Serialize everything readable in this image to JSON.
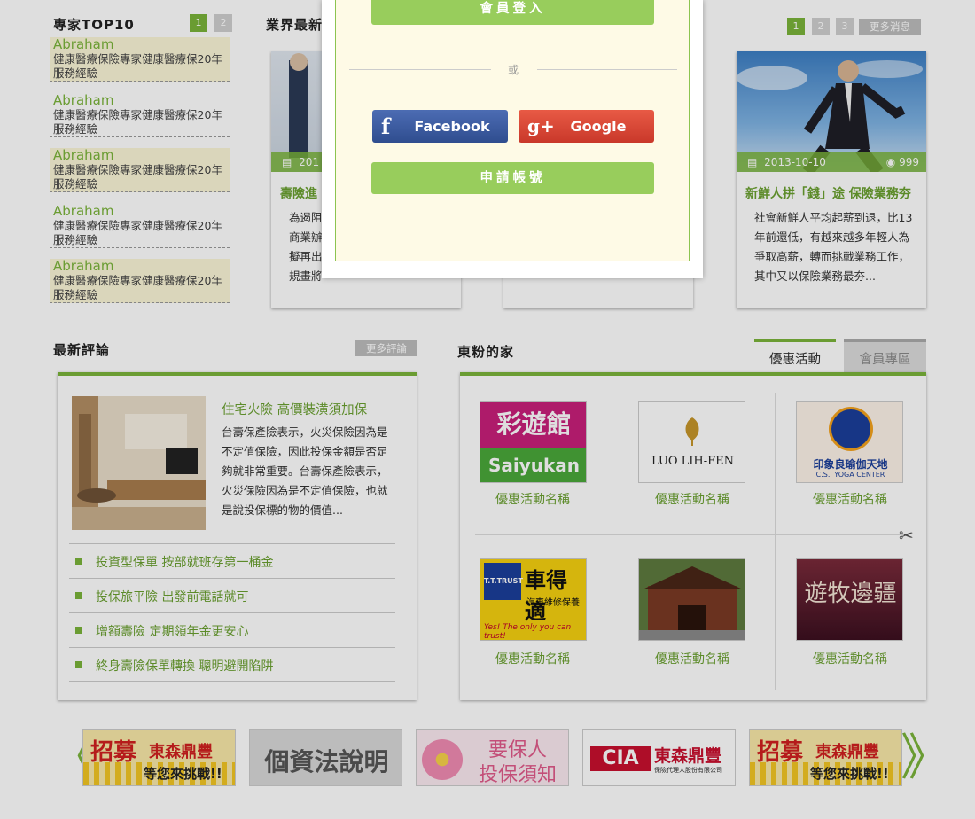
{
  "expert_top10": {
    "title": "專家TOP10",
    "pages": [
      "1",
      "2"
    ],
    "items": [
      {
        "name": "Abraham",
        "desc": "健康醫療保險專家健康醫療保20年服務經驗"
      },
      {
        "name": "Abraham",
        "desc": "健康醫療保險專家健康醫療保20年服務經驗"
      },
      {
        "name": "Abraham",
        "desc": "健康醫療保險專家健康醫療保20年服務經驗"
      },
      {
        "name": "Abraham",
        "desc": "健康醫療保險專家健康醫療保20年服務經驗"
      },
      {
        "name": "Abraham",
        "desc": "健康醫療保險專家健康醫療保20年服務經驗"
      }
    ]
  },
  "industry_news": {
    "title": "業界最新",
    "pages": [
      "1",
      "2",
      "3"
    ],
    "more_label": "更多消息",
    "cards": [
      {
        "date": "201",
        "title": "壽險進",
        "body": "為遏阻\n商業辦\n擬再出\n規畫將"
      },
      {
        "date": "",
        "title": "",
        "body": ""
      },
      {
        "date": "2013-10-10",
        "views": "999",
        "title": "新鮮人拼「錢」途 保險業務夯",
        "body": "社會新鮮人平均起薪到退，比13年前還低，有越來越多年輕人為爭取高薪，轉而挑戰業務工作，其中又以保險業務最夯..."
      }
    ]
  },
  "latest_comments": {
    "title": "最新評論",
    "more_label": "更多評論",
    "featured": {
      "title": "住宅火險 高價裝潢須加保",
      "body": "台壽保產險表示，火災保險因為是不定值保險，因此投保金額是否足夠就非常重要。台壽保產險表示，火災保險因為是不定值保險，也就是說投保標的物的價值..."
    },
    "list": [
      "投資型保單 按部就班存第一桶金",
      "投保旅平險 出發前電話就可",
      "增額壽險 定期領年金更安心",
      "終身壽險保單轉換 聰明避開陷阱"
    ]
  },
  "fans_home": {
    "title": "東粉的家",
    "tabs": [
      "優惠活動",
      "會員專區"
    ],
    "promos": [
      {
        "logo_text": "彩遊館",
        "logo_sub": "Saiyukan",
        "name": "優惠活動名稱"
      },
      {
        "logo_text": "LUO LIH-FEN",
        "logo_sub": "",
        "name": "優惠活動名稱"
      },
      {
        "logo_text": "印象良瑜伽天地",
        "logo_sub": "C.S.I YOGA CENTER",
        "name": "優惠活動名稱"
      },
      {
        "logo_text": "車得適",
        "logo_sub": "汽車維修保養",
        "logo_tag": "T.T.TRUST",
        "logo_slogan": "Yes! The only you can trust!",
        "name": "優惠活動名稱"
      },
      {
        "logo_text": "",
        "logo_sub": "",
        "name": "優惠活動名稱"
      },
      {
        "logo_text": "遊牧邊疆",
        "logo_sub": "",
        "name": "優惠活動名稱"
      }
    ]
  },
  "banners": [
    {
      "line1": "招募",
      "line2": "東森鼎豐",
      "line3": "等您來挑戰!!"
    },
    {
      "line1": "個資法說明"
    },
    {
      "line1": "要保人",
      "line2": "投保須知"
    },
    {
      "line1": "東森鼎豐",
      "line2": "保險代理人股份有限公司"
    },
    {
      "line1": "招募",
      "line2": "東森鼎豐",
      "line3": "等您來挑戰!!"
    }
  ],
  "banner_nav": {
    "prev": "《",
    "next": "》"
  },
  "login_modal": {
    "login_label": "會員登入",
    "divider_text": "或",
    "facebook_label": "Facebook",
    "google_label": "Google",
    "register_label": "申請帳號"
  },
  "colors": {
    "accent": "#7ab43a",
    "facebook": "#3b5998",
    "google": "#dd4b39"
  }
}
